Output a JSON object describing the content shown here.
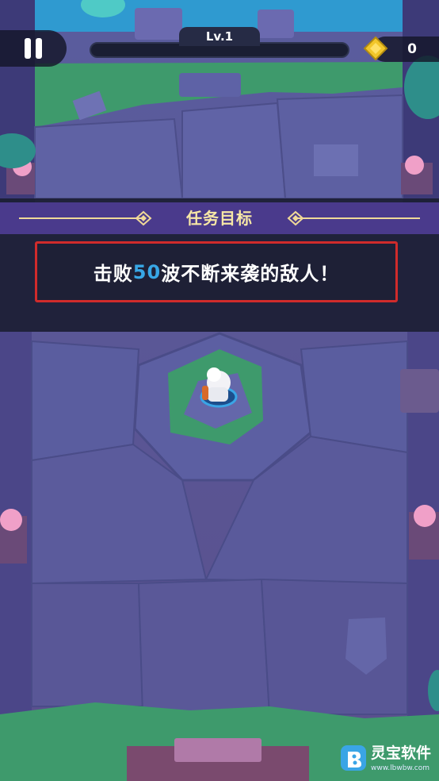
{
  "hud": {
    "level_label": "Lv.1",
    "xp_progress": 0,
    "coin_count": "0",
    "pause_icon": "pause-icon",
    "coin_icon": "gold-coin-icon"
  },
  "mission": {
    "header": "任务目标",
    "objective_prefix": "击败",
    "objective_number": "50",
    "objective_suffix": "波不断来袭的敌人！",
    "highlight_color": "#38a7e6",
    "border_color": "#d02b2b"
  },
  "watermark": {
    "name": "灵宝软件",
    "url": "www.lbwbw.com"
  },
  "colors": {
    "floor": "#5a5a98",
    "grass": "#3e9a6c",
    "header_band": "#4a3a8c",
    "title_text": "#f7e7a6"
  }
}
